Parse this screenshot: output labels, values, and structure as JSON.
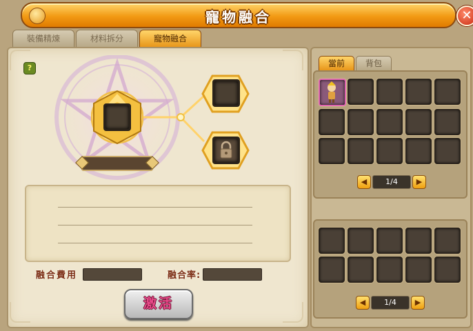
{
  "window": {
    "title": "寵物融合"
  },
  "tabs": [
    {
      "label": "裝備精煉",
      "active": false
    },
    {
      "label": "材料拆分",
      "active": false
    },
    {
      "label": "寵物融合",
      "active": true
    }
  ],
  "fusion": {
    "help_label": "?",
    "cost_label": "融合費用",
    "cost_value": "",
    "rate_label": "融合率:",
    "rate_value": "",
    "activate_label": "激活"
  },
  "inventory": {
    "tabs": [
      {
        "label": "當前",
        "active": true
      },
      {
        "label": "背包",
        "active": false
      }
    ],
    "top_grid": {
      "rows": 3,
      "cols": 5,
      "filled_slots": [
        "pet-1"
      ],
      "page": "1/4"
    },
    "bottom_grid": {
      "rows": 2,
      "cols": 5,
      "page": "1/4"
    }
  },
  "colors": {
    "accent": "#f29a14",
    "title_text": "#ffffff",
    "label_text": "#7a2a10",
    "activate_text": "#e94a8a"
  }
}
